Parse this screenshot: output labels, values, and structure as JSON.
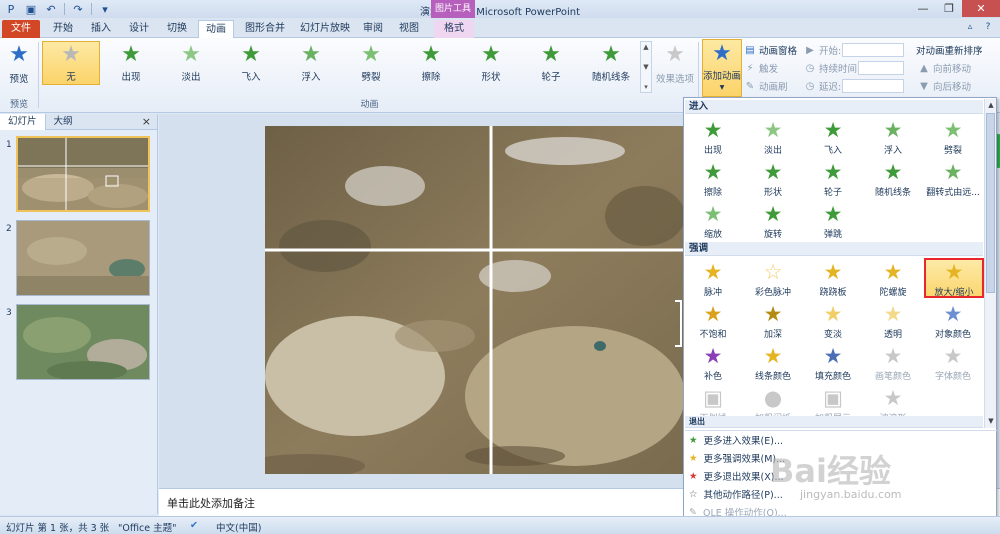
{
  "app": {
    "title": "演示文稿1 - Microsoft PowerPoint",
    "context_tool": "图片工具"
  },
  "colors": {
    "file_tab": "#d24726",
    "selected_gallery": "#fbd36a",
    "highlight_box": "#e8262b",
    "context_tab": "#b65fbd",
    "star_green": "#3f9a3a",
    "star_gold": "#e4b423"
  },
  "tabs": [
    "文件",
    "开始",
    "插入",
    "设计",
    "切换",
    "动画",
    "图形合并",
    "幻灯片放映",
    "审阅",
    "视图",
    "格式"
  ],
  "ribbon": {
    "preview": {
      "label": "预览",
      "group": "预览",
      "icon": "preview-star-icon"
    },
    "gallery": [
      "无",
      "出现",
      "淡出",
      "飞入",
      "浮入",
      "劈裂",
      "擦除",
      "形状",
      "轮子",
      "随机线条"
    ],
    "effect_options": "效果选项",
    "group_animation": "动画",
    "add_animation": "添加动画",
    "pane": "动画窗格",
    "trigger": "触发",
    "painter": "动画刷",
    "start_label": "开始:",
    "duration_label": "持续时间:",
    "delay_label": "延迟:",
    "reorder_title": "对动画重新排序",
    "move_earlier": "向前移动",
    "move_later": "向后移动"
  },
  "left_panel": {
    "tab_slides": "幻灯片",
    "tab_outline": "大纲",
    "close": "×",
    "slides": [
      "1",
      "2",
      "3"
    ]
  },
  "notes_placeholder": "单击此处添加备注",
  "dropdown": {
    "section_enter": "进入",
    "enter": [
      "出现",
      "淡出",
      "飞入",
      "浮入",
      "劈裂",
      "擦除",
      "形状",
      "轮子",
      "随机线条",
      "翻转式由远...",
      "缩放",
      "旋转",
      "弹跳"
    ],
    "section_emphasis": "强调",
    "emphasis": [
      "脉冲",
      "彩色脉冲",
      "跷跷板",
      "陀螺旋",
      "放大/缩小",
      "不饱和",
      "加深",
      "变淡",
      "透明",
      "对象颜色",
      "补色",
      "线条颜色",
      "填充颜色",
      "画笔颜色",
      "字体颜色",
      "下划线",
      "加粗闪烁",
      "加粗展示",
      "波浪形"
    ],
    "section_exit": "退出",
    "menu": [
      "更多进入效果(E)...",
      "更多强调效果(M)...",
      "更多退出效果(X)...",
      "其他动作路径(P)...",
      "OLE 操作动作(O)..."
    ]
  },
  "statusbar": {
    "slide_info": "幻灯片 第 1 张，共 3 张",
    "theme": "\"Office 主题\"",
    "language": "中文(中国)"
  },
  "watermark": {
    "brand": "Bai经验",
    "url": "jingyan.baidu.com"
  }
}
